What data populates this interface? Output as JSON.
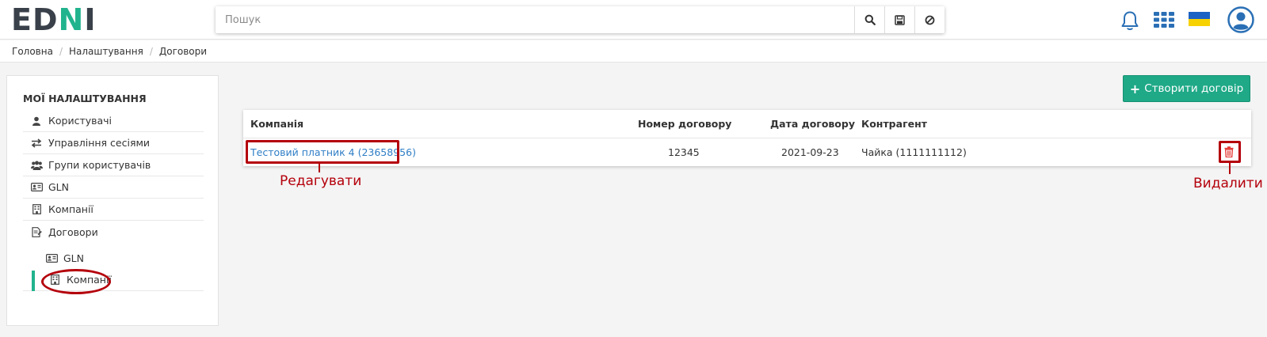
{
  "logo": {
    "part1": "ED",
    "part2": "N",
    "part3": "I"
  },
  "search": {
    "placeholder": "Пошук"
  },
  "header_icons": [
    "bell-icon",
    "apps-grid-icon",
    "ukraine-flag-icon",
    "user-avatar-icon"
  ],
  "breadcrumb": [
    "Головна",
    "Налаштування",
    "Договори"
  ],
  "sidebar": {
    "title": "МОЇ НАЛАШТУВАННЯ",
    "items": [
      {
        "label": "Користувачі",
        "icon": "user-icon"
      },
      {
        "label": "Управління сесіями",
        "icon": "exchange-icon"
      },
      {
        "label": "Групи користувачів",
        "icon": "users-icon"
      },
      {
        "label": "GLN",
        "icon": "id-card-icon"
      },
      {
        "label": "Компанії",
        "icon": "building-icon"
      },
      {
        "label": "Договори",
        "icon": "contract-icon"
      }
    ],
    "subitems": [
      {
        "label": "GLN",
        "icon": "id-card-icon"
      },
      {
        "label": "Компанії",
        "icon": "building-icon",
        "active": true
      }
    ]
  },
  "actions": {
    "create_label": "Створити договір"
  },
  "table": {
    "headers": [
      "Компанія",
      "Номер договору",
      "Дата договору",
      "Контрагент"
    ],
    "rows": [
      {
        "company": "Тестовий платник 4 (23658956)",
        "number": "12345",
        "date": "2021-09-23",
        "counterparty": "Чайка (1111111112)"
      }
    ]
  },
  "annotations": {
    "edit": "Редагувати",
    "delete": "Видалити"
  },
  "colors": {
    "accent": "#21b38d",
    "button": "#1fa987",
    "link": "#2f7ec6",
    "annotation": "#b4000b",
    "delete_icon": "#e53935"
  }
}
